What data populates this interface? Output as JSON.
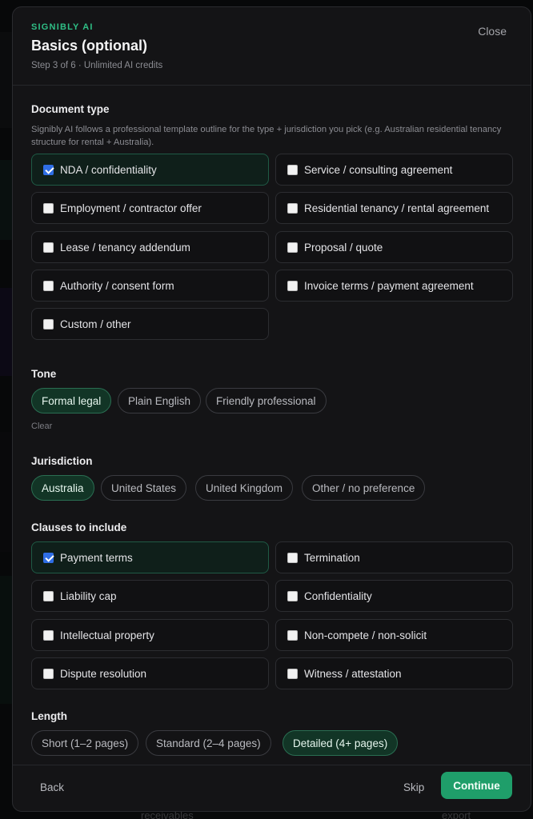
{
  "header": {
    "brand": "SIGNIBLY AI",
    "title": "Basics (optional)",
    "subtitle": "Step 3 of 6 · Unlimited AI credits",
    "close_label": "Close"
  },
  "document_type": {
    "label": "Document type",
    "helper": "Signibly AI follows a professional template outline for the type + jurisdiction you pick (e.g. Australian residential tenancy structure for rental + Australia).",
    "options": [
      {
        "label": "NDA / confidentiality",
        "checked": true
      },
      {
        "label": "Service / consulting agreement",
        "checked": false
      },
      {
        "label": "Employment / contractor offer",
        "checked": false
      },
      {
        "label": "Residential tenancy / rental agreement",
        "checked": false
      },
      {
        "label": "Lease / tenancy addendum",
        "checked": false
      },
      {
        "label": "Proposal / quote",
        "checked": false
      },
      {
        "label": "Authority / consent form",
        "checked": false
      },
      {
        "label": "Invoice terms / payment agreement",
        "checked": false
      },
      {
        "label": "Custom / other",
        "checked": false
      }
    ]
  },
  "tone": {
    "label": "Tone",
    "options": [
      {
        "label": "Formal legal",
        "active": true
      },
      {
        "label": "Plain English",
        "active": false
      },
      {
        "label": "Friendly professional",
        "active": false
      }
    ],
    "clear_label": "Clear"
  },
  "jurisdiction": {
    "label": "Jurisdiction",
    "options": [
      {
        "label": "Australia",
        "active": true
      },
      {
        "label": "United States",
        "active": false
      },
      {
        "label": "United Kingdom",
        "active": false
      },
      {
        "label": "Other / no preference",
        "active": false
      }
    ]
  },
  "clauses": {
    "label": "Clauses to include",
    "options": [
      {
        "label": "Payment terms",
        "checked": true
      },
      {
        "label": "Termination",
        "checked": false
      },
      {
        "label": "Liability cap",
        "checked": false
      },
      {
        "label": "Confidentiality",
        "checked": false
      },
      {
        "label": "Intellectual property",
        "checked": false
      },
      {
        "label": "Non-compete / non-solicit",
        "checked": false
      },
      {
        "label": "Dispute resolution",
        "checked": false
      },
      {
        "label": "Witness / attestation",
        "checked": false
      }
    ]
  },
  "length": {
    "label": "Length",
    "options": [
      {
        "label": "Short (1–2 pages)",
        "active": false
      },
      {
        "label": "Standard (2–4 pages)",
        "active": false
      },
      {
        "label": "Detailed (4+ pages)",
        "active": true
      }
    ]
  },
  "footer": {
    "back_label": "Back",
    "skip_label": "Skip",
    "continue_label": "Continue"
  },
  "background": {
    "bottom_left_text": "receivables",
    "bottom_right_text": "export"
  }
}
